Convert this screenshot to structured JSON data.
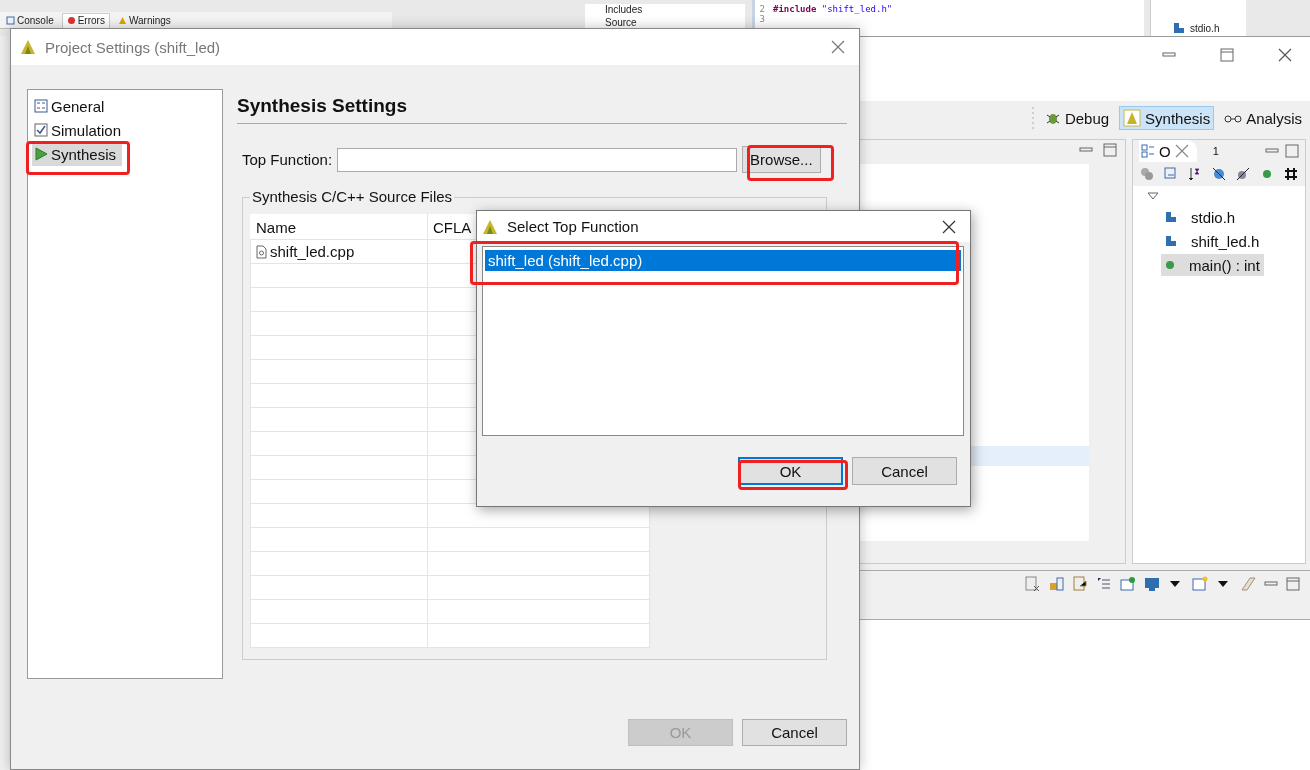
{
  "background_ide": {
    "console_tabs": [
      {
        "label": "Console",
        "selected": false
      },
      {
        "label": "Errors",
        "selected": true
      },
      {
        "label": "Warnings",
        "selected": false
      }
    ],
    "project_tree": [
      {
        "label": "Includes"
      },
      {
        "label": "Source"
      }
    ],
    "editor_lines": [
      {
        "number": "2",
        "code": "#include \"shift_led.h\""
      },
      {
        "number": "3"
      }
    ],
    "top_outline_item": "stdio.h",
    "perspectives": [
      {
        "label": "Debug",
        "selected": false
      },
      {
        "label": "Synthesis",
        "selected": true
      },
      {
        "label": "Analysis",
        "selected": false
      }
    ],
    "outline": {
      "tab": "O",
      "overflow": "1",
      "items": [
        {
          "label": "stdio.h",
          "kind": "include",
          "selected": false
        },
        {
          "label": "shift_led.h",
          "kind": "include",
          "selected": false
        },
        {
          "label": "main() : int",
          "kind": "function",
          "selected": true
        }
      ]
    }
  },
  "project_settings": {
    "title": "Project Settings (shift_led)",
    "sidebar": [
      {
        "label": "General",
        "kind": "general",
        "selected": false,
        "highlighted": false
      },
      {
        "label": "Simulation",
        "kind": "simulation",
        "selected": false,
        "highlighted": false
      },
      {
        "label": "Synthesis",
        "kind": "synthesis",
        "selected": true,
        "highlighted": true
      }
    ],
    "heading": "Synthesis Settings",
    "top_function": {
      "label": "Top Function:"
    },
    "browse_button": {
      "label": "Browse...",
      "highlighted": true
    },
    "source_files": {
      "title": "Synthesis C/C++ Source Files",
      "columns": [
        "Name",
        "CFLA"
      ],
      "rows": [
        {
          "name": "shift_led.cpp"
        }
      ]
    },
    "buttons": [
      {
        "label": "OK",
        "disabled": true
      },
      {
        "label": "Cancel",
        "disabled": false
      }
    ]
  },
  "select_top_function": {
    "title": "Select Top Function",
    "items": [
      {
        "label": "shift_led (shift_led.cpp)",
        "selected": true,
        "highlighted": true
      }
    ],
    "buttons": [
      {
        "label": "OK",
        "default": true,
        "highlighted": true
      },
      {
        "label": "Cancel",
        "default": false,
        "highlighted": false
      }
    ]
  }
}
